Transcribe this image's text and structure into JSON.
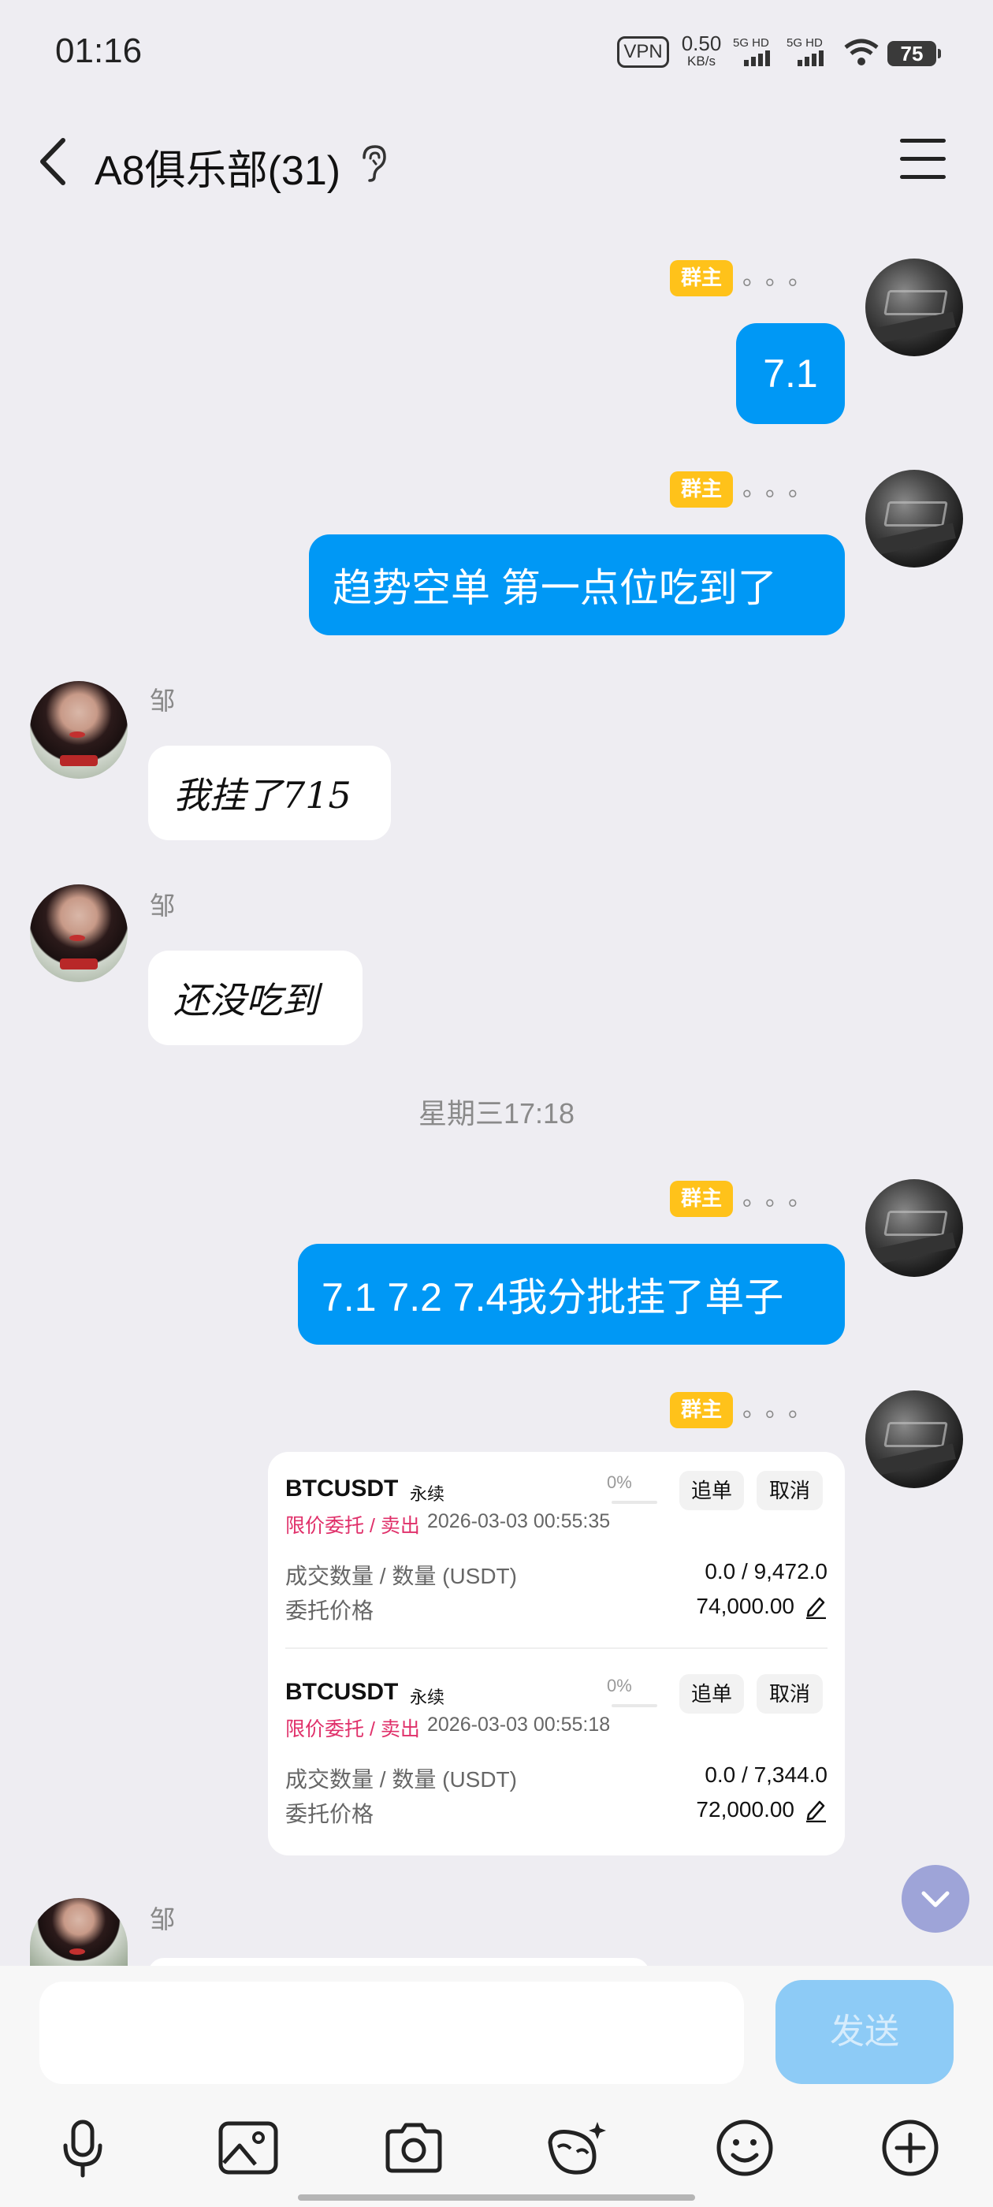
{
  "status_bar": {
    "time": "01:16",
    "vpn": "VPN",
    "speed_value": "0.50",
    "speed_unit": "KB/s",
    "sim1": "5G HD",
    "sim2": "5G HD",
    "battery": "75",
    "wifi_icon": "wifi-icon"
  },
  "header": {
    "title": "A8俱乐部(31)",
    "back_icon": "chevron-left-icon",
    "ear_icon": "ear-icon",
    "menu_icon": "menu-icon"
  },
  "messages": [
    {
      "side": "right",
      "badge": "群主",
      "dots": "。。。",
      "text": "7.1"
    },
    {
      "side": "right",
      "badge": "群主",
      "dots": "。。。",
      "text": "趋势空单  第一点位吃到了"
    },
    {
      "side": "left",
      "sender": "邹",
      "text": "我挂了715"
    },
    {
      "side": "left",
      "sender": "邹",
      "text": "还没吃到"
    },
    {
      "side": "right",
      "badge": "群主",
      "dots": "。。。",
      "text": "7.1  7.2  7.4我分批挂了单子"
    },
    {
      "side": "right",
      "badge": "群主",
      "dots": "。。。",
      "type": "order-card"
    },
    {
      "side": "left",
      "sender": "邹"
    }
  ],
  "timestamp": "星期三17:18",
  "order_card": {
    "orders": [
      {
        "symbol": "BTCUSDT",
        "perp": "永续",
        "progress": "0%",
        "progress_fraction": 0,
        "follow_label": "追单",
        "cancel_label": "取消",
        "side": "限价委托 / 卖出",
        "datetime": "2026-03-03 00:55:35",
        "filled_label": "成交数量 / 数量 (USDT)",
        "filled_value": "0.0 / 9,472.0",
        "price_label": "委托价格",
        "price_value": "74,000.00"
      },
      {
        "symbol": "BTCUSDT",
        "perp": "永续",
        "progress": "0%",
        "progress_fraction": 0,
        "follow_label": "追单",
        "cancel_label": "取消",
        "side": "限价委托 / 卖出",
        "datetime": "2026-03-03 00:55:18",
        "filled_label": "成交数量 / 数量 (USDT)",
        "filled_value": "0.0 / 7,344.0",
        "price_label": "委托价格",
        "price_value": "72,000.00"
      }
    ]
  },
  "input": {
    "placeholder": "",
    "value": ""
  },
  "send_label": "发送",
  "toolbar": [
    "microphone-icon",
    "image-icon",
    "camera-icon",
    "mask-icon",
    "emoji-icon",
    "plus-circle-icon"
  ],
  "colors": {
    "bubble_self": "#0098f5",
    "owner_badge": "#ffc21a",
    "sell_text": "#e0306a",
    "send_button_disabled": "#8dcbf6"
  }
}
